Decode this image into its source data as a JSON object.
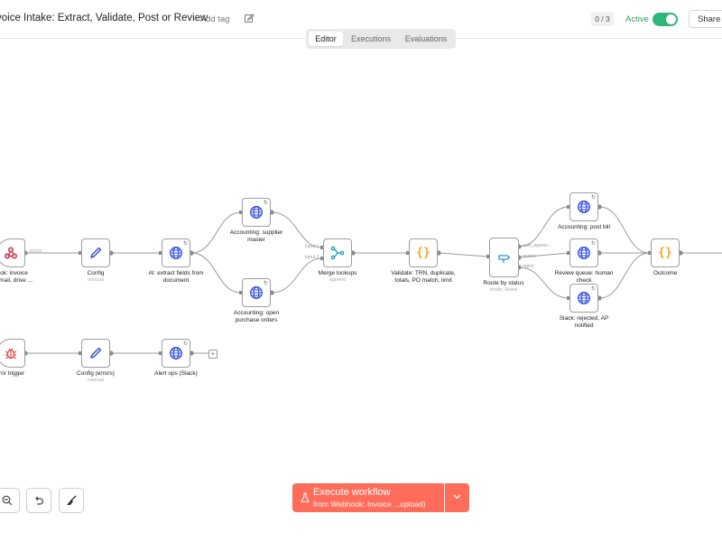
{
  "header": {
    "title": "voice Intake: Extract, Validate, Post or Review",
    "add_tag": "+ Add tag",
    "counter": "0 / 3",
    "active_label": "Active",
    "share_label": "Share"
  },
  "tabs": [
    {
      "label": "Editor",
      "active": true
    },
    {
      "label": "Executions",
      "active": false
    },
    {
      "label": "Evaluations",
      "active": false
    }
  ],
  "nodes": {
    "webhook": {
      "label": "hook: invoice",
      "label2": "d (email, drive ...",
      "icon": "webhook-icon"
    },
    "config": {
      "label": "Config",
      "sub": "manual",
      "icon": "pencil-icon"
    },
    "ai_extract": {
      "label": "AI: extract fields from",
      "label2": "document",
      "icon": "globe-icon"
    },
    "supplier": {
      "label": "Accounting: supplier",
      "label2": "master",
      "icon": "globe-icon"
    },
    "po": {
      "label": "Accounting: open",
      "label2": "purchase orders",
      "icon": "globe-icon"
    },
    "merge": {
      "label": "Merge lookups",
      "sub": "append",
      "icon": "merge-icon"
    },
    "validate": {
      "label": "Validate: TRN, duplicate,",
      "label2": "totals, PO match, limit",
      "icon": "code-icon",
      "glyph": "{}"
    },
    "route": {
      "label": "Route by status",
      "sub": "mode: Rules",
      "icon": "switch-icon"
    },
    "post_bill": {
      "label": "Accounting: post bill",
      "icon": "globe-icon"
    },
    "review": {
      "label": "Review queue: human",
      "label2": "check",
      "icon": "globe-icon"
    },
    "slack": {
      "label": "Slack: rejected, AP",
      "label2": "notified",
      "icon": "globe-icon"
    },
    "outcome": {
      "label": "Outcome",
      "icon": "code-icon",
      "glyph": "{}"
    },
    "err_trigger": {
      "label": "rror trigger",
      "icon": "bug-icon"
    },
    "err_config": {
      "label": "Config (errors)",
      "sub": "manual",
      "icon": "pencil-icon"
    },
    "alert": {
      "label": "Alert ops (Slack)",
      "icon": "globe-icon"
    }
  },
  "edge_labels": {
    "post": "POST",
    "input1": "Input 1",
    "input2": "Input 2",
    "auto": "auto_approv...",
    "review": "review",
    "reject": "reject"
  },
  "execute": {
    "label": "Execute workflow",
    "from_prefix": "from",
    "from_target": "Webhook: Invoice ...upload)"
  },
  "colors": {
    "accent": "#ff6d5a",
    "active": "#2fb67a",
    "globe": "#2f4cdd",
    "code": "#f5a623",
    "merge": "#0b9fb8",
    "bug": "#e24a4a",
    "pencil": "#3a55c4"
  }
}
